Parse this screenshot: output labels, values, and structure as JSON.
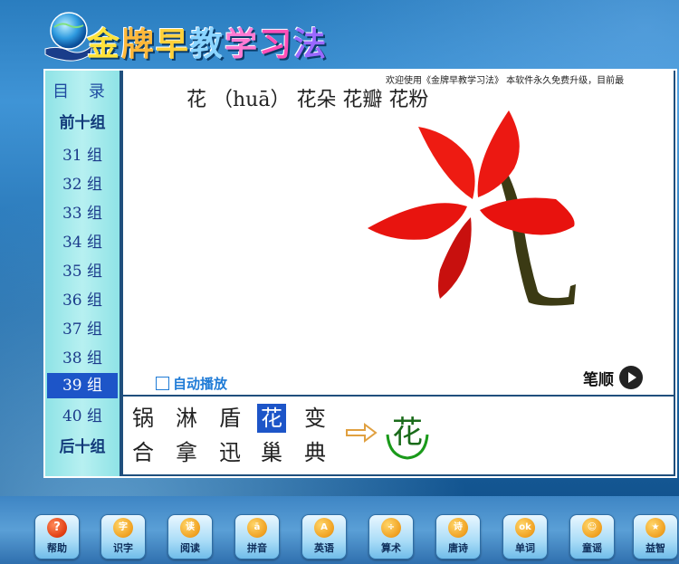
{
  "header": {
    "title_chars": [
      "金",
      "牌",
      "早",
      "教",
      "学",
      "习",
      "法"
    ]
  },
  "sidebar": {
    "title": "目 录",
    "prev_group": "前十组",
    "next_group": "后十组",
    "groups": [
      "31 组",
      "32 组",
      "33 组",
      "34 组",
      "35 组",
      "36 组",
      "37 组",
      "38 组",
      "39 组",
      "40 组"
    ],
    "active_group": "39 组"
  },
  "content": {
    "marquee": "欢迎使用《金牌早教学习法》    本软件永久免费升级，目前最",
    "word_line": "花  （huā）  花朵 花瓣 花粉",
    "autoplay_label": "自动播放",
    "stroke_order_label": "笔顺"
  },
  "characters": {
    "row1": [
      "锅",
      "淋",
      "盾",
      "花",
      "变"
    ],
    "row2": [
      "合",
      "拿",
      "迅",
      "巢",
      "典"
    ],
    "selected": "花",
    "display": "花"
  },
  "toolbar": {
    "buttons": [
      {
        "label": "帮助",
        "icon": "?"
      },
      {
        "label": "识字",
        "icon": "字"
      },
      {
        "label": "阅读",
        "icon": "读"
      },
      {
        "label": "拼音",
        "icon": "ā"
      },
      {
        "label": "英语",
        "icon": "A"
      },
      {
        "label": "算术",
        "icon": "÷"
      },
      {
        "label": "唐诗",
        "icon": "诗"
      },
      {
        "label": "单词",
        "icon": "ok"
      },
      {
        "label": "童谣",
        "icon": "☺"
      },
      {
        "label": "益智",
        "icon": "★"
      }
    ]
  },
  "colors": {
    "accent": "#1d55c8",
    "sidebar_bg": "#b7f0f1",
    "background": "#2a7dbf",
    "petal": "#e8120e",
    "stem": "#3b3a14"
  }
}
